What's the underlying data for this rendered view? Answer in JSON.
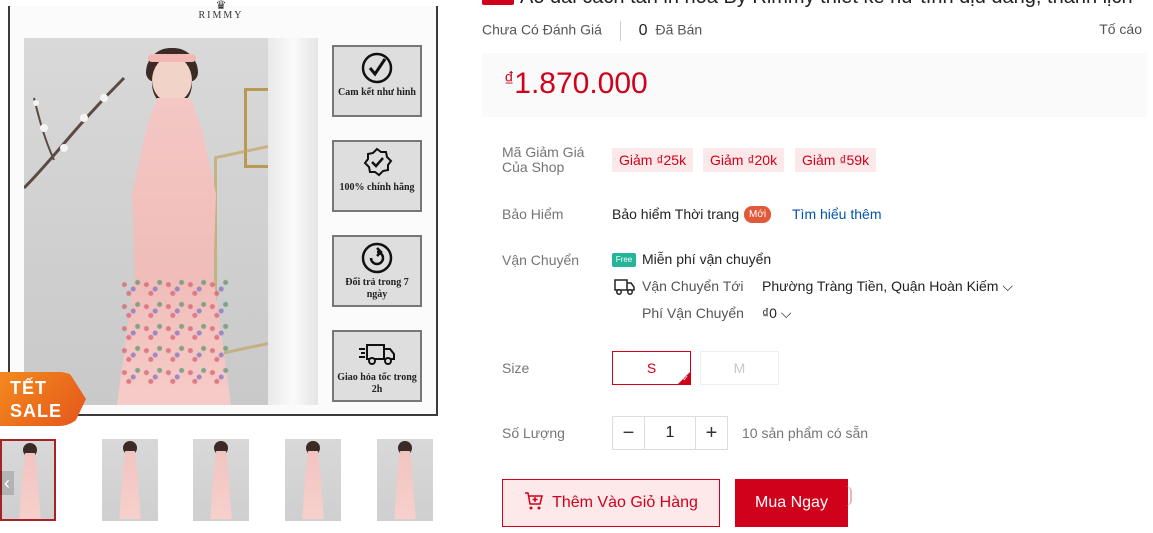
{
  "gallery": {
    "brand_name": "RIMMY",
    "features": [
      {
        "icon": "check-circle-icon",
        "label": "Cam kết như hình"
      },
      {
        "icon": "badge-icon",
        "label": "100% chính hãng"
      },
      {
        "icon": "return-icon",
        "label": "Đổi trả trong 7 ngày"
      },
      {
        "icon": "delivery-truck-icon",
        "label": "Giao hỏa tốc trong 2h"
      }
    ],
    "promo_badge_line1": "TẾT",
    "promo_badge_line2": "SALE",
    "thumbnail_count": 5,
    "active_thumbnail": 0
  },
  "product": {
    "title": "Áo dài cách tân in hoa By Rimmy thiết kế nữ tính dịu dàng, thanh lịch",
    "rating_text": "Chưa Có Đánh Giá",
    "sold_count": "0",
    "sold_label": "Đã Bán",
    "report_label": "Tố cáo",
    "price_currency": "₫",
    "price": "1.870.000"
  },
  "vouchers": {
    "label": "Mã Giảm Giá Của Shop",
    "items": [
      "Giảm ₫25k",
      "Giảm ₫20k",
      "Giảm ₫59k"
    ]
  },
  "insurance": {
    "label": "Bảo Hiểm",
    "name": "Bảo hiểm Thời trang",
    "badge": "Mới",
    "link": "Tìm hiểu thêm"
  },
  "shipping": {
    "label": "Vận Chuyển",
    "free_icon_text": "Free",
    "free_text": "Miễn phí vận chuyển",
    "to_label": "Vận Chuyển Tới",
    "to_value": "Phường Tràng Tiền, Quận Hoàn Kiếm ⌵",
    "fee_label": "Phí Vận Chuyển",
    "fee_value": "₫0 ⌵"
  },
  "size": {
    "label": "Size",
    "options": [
      "S",
      "M"
    ],
    "selected": "S"
  },
  "quantity": {
    "label": "Số Lượng",
    "minus": "−",
    "value": "1",
    "plus": "+",
    "stock_text": "10 sản phẩm có sẵn"
  },
  "actions": {
    "add_to_cart": "Thêm Vào Giỏ Hàng",
    "buy_now": "Mua Ngay"
  },
  "colors": {
    "accent": "#d0011b",
    "voucher_bg": "#fbe9ea",
    "link": "#0055aa"
  }
}
